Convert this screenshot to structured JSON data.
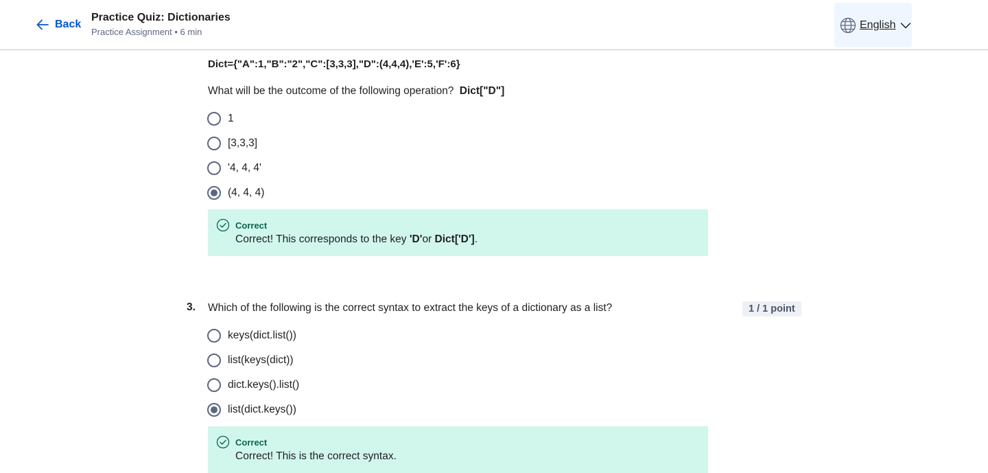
{
  "header": {
    "back_label": "Back",
    "title": "Practice Quiz: Dictionaries",
    "subtitle": "Practice Assignment • 6 min",
    "language": "English"
  },
  "question2": {
    "dict_definition": "Dict={\"A\":1,\"B\":\"2\",\"C\":[3,3,3],\"D\":(4,4,4),'E':5,'F':6}",
    "prompt": "What will be the outcome of the following operation?",
    "prompt_code": "Dict[\"D\"]",
    "options": [
      "1",
      "[3,3,3]",
      "'4, 4, 4'",
      "(4, 4, 4)"
    ],
    "selected_index": 3,
    "feedback": {
      "title": "Correct",
      "text_prefix": "Correct! This corresponds to the key ",
      "key_code": "'D'",
      "text_mid": "or ",
      "dict_code": "Dict['D']",
      "text_suffix": "."
    }
  },
  "question3": {
    "number": "3.",
    "prompt": "Which of the following is the correct syntax to extract the keys of a dictionary as a list?",
    "points": "1 / 1 point",
    "options": [
      "keys(dict.list())",
      "list(keys(dict))",
      "dict.keys().list()",
      "list(dict.keys())"
    ],
    "selected_index": 3,
    "feedback": {
      "title": "Correct",
      "text": "Correct! This is the correct syntax."
    }
  },
  "colors": {
    "accent": "#0056d2",
    "feedback_bg": "#d1f7ec",
    "feedback_title": "#0a6649",
    "radio": "#5b6780"
  },
  "icons": {
    "back": "arrow-left-icon",
    "language": "globe-icon",
    "dropdown": "chevron-down-icon",
    "correct": "check-circle-icon"
  }
}
